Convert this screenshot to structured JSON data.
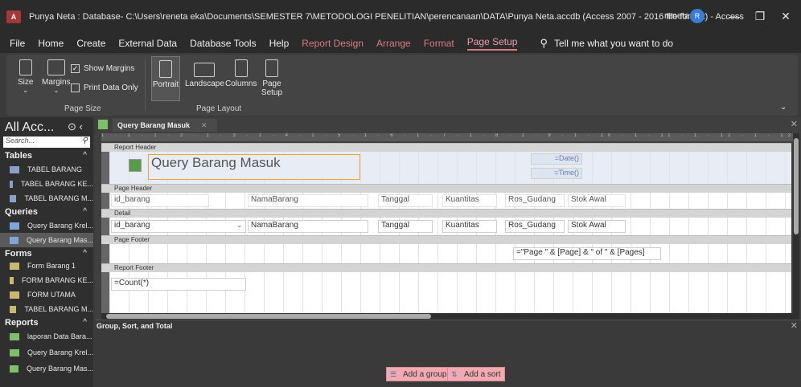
{
  "window": {
    "title": "Punya Neta : Database- C:\\Users\\reneta eka\\Documents\\SEMESTER 7\\METODOLOGI PENELITIAN\\perencanaan\\DATA\\Punya Neta.accdb (Access 2007 - 2016 file format) - Access",
    "app_icon": "A",
    "user": "reneta",
    "avatar_initial": "R"
  },
  "menu": {
    "items": [
      "File",
      "Home",
      "Create",
      "External Data",
      "Database Tools",
      "Help"
    ],
    "context_items": [
      "Report Design",
      "Arrange",
      "Format"
    ],
    "active_item": "Page Setup",
    "tell_me": "Tell me what you want to do"
  },
  "ribbon": {
    "size_label": "Size",
    "margins_label": "Margins",
    "show_margins": "Show Margins",
    "print_data_only": "Print Data Only",
    "page_size_group": "Page Size",
    "portrait": "Portrait",
    "landscape": "Landscape",
    "columns": "Columns",
    "page_setup": "Page Setup",
    "page_layout_group": "Page Layout"
  },
  "nav": {
    "title": "All Acc...",
    "search_placeholder": "Search...",
    "sections": {
      "tables": "Tables",
      "queries": "Queries",
      "forms": "Forms",
      "reports": "Reports"
    },
    "tables": [
      "TABEL BARANG",
      "TABEL BARANG KE...",
      "TABEL BARANG M..."
    ],
    "queries": [
      "Query Barang Krel...",
      "Query Barang Mas..."
    ],
    "forms": [
      "Form Barang 1",
      "FORM BARANG KE...",
      "FORM UTAMA",
      "TABEL BARANG M..."
    ],
    "reports": [
      "laporan Data Bara...",
      "Query Barang Krel...",
      "Query Barang Mas..."
    ]
  },
  "document": {
    "tab": "Query Barang Masuk",
    "ruler": "1 · 1 · 1 · 2 · 1 · 3 · 1 · 4 · 1 · 5 · 1 · 6 · 1 · 7 · 1 · 8 · 1 · 9 · 1 · 10 · 1 · 11 · 1 · 12 · 1 · 13 · 1 · 14 · 1 · 15 · 1 · 16 · 1 · 17 · 1 · 18 · 1 · 19 · 1 · 20 · 1 · 21 · 1 · 22 · 1 · 23 · 1 · 24 · 1 · 25 · 1 · 26 · 1 · 27 · 1 · 28 · 1 · 2"
  },
  "report": {
    "sections": {
      "report_header": "Report Header",
      "page_header": "Page Header",
      "detail": "Detail",
      "page_footer": "Page Footer",
      "report_footer": "Report Footer"
    },
    "title": "Query Barang Masuk",
    "date_expr": "=Date()",
    "time_expr": "=Time()",
    "header_labels": [
      "id_barang",
      "NamaBarang",
      "Tanggal",
      "Kuantitas",
      "Ros_Gudang",
      "Stok Awal"
    ],
    "detail_fields": [
      "id_barang",
      "NamaBarang",
      "Tanggal",
      "Kuantitas",
      "Ros_Gudang",
      "Stok Awal"
    ],
    "page_expr": "=\"Page \" & [Page] & \" of \" & [Pages]",
    "count_expr": "=Count(*)"
  },
  "group_sort": {
    "title": "Group, Sort, and Total",
    "add_group": "Add a group",
    "add_sort": "Add a sort"
  }
}
